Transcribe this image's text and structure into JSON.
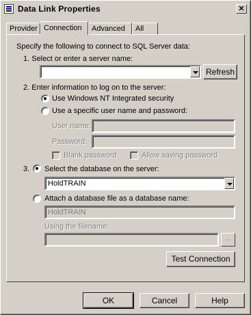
{
  "window": {
    "title": "Data Link Properties",
    "close_glyph": "✕"
  },
  "tabs": [
    {
      "label": "Provider"
    },
    {
      "label": "Connection"
    },
    {
      "label": "Advanced"
    },
    {
      "label": "All"
    }
  ],
  "connection": {
    "intro": "Specify the following to connect to SQL Server data:",
    "step1": "1. Select or enter a server name:",
    "server_value": "",
    "refresh_label": "Refresh",
    "step2": "2. Enter information to log on to the server:",
    "use_nt_security": "Use Windows NT Integrated security",
    "use_specific": "Use a specific user name and password:",
    "username_label": "User name:",
    "password_label": "Password:",
    "blank_password": "Blank password",
    "allow_saving": "Allow saving password",
    "step3_number": "3.",
    "select_db": "Select the database on the server:",
    "db_value": "HoldTRAIN",
    "attach_db": "Attach a database file as a database name:",
    "attach_value": "HoldTRAIN",
    "using_filename": "Using the filename:",
    "browse_label": "...",
    "test_connection": "Test Connection"
  },
  "footer": {
    "ok": "OK",
    "cancel": "Cancel",
    "help": "Help"
  }
}
